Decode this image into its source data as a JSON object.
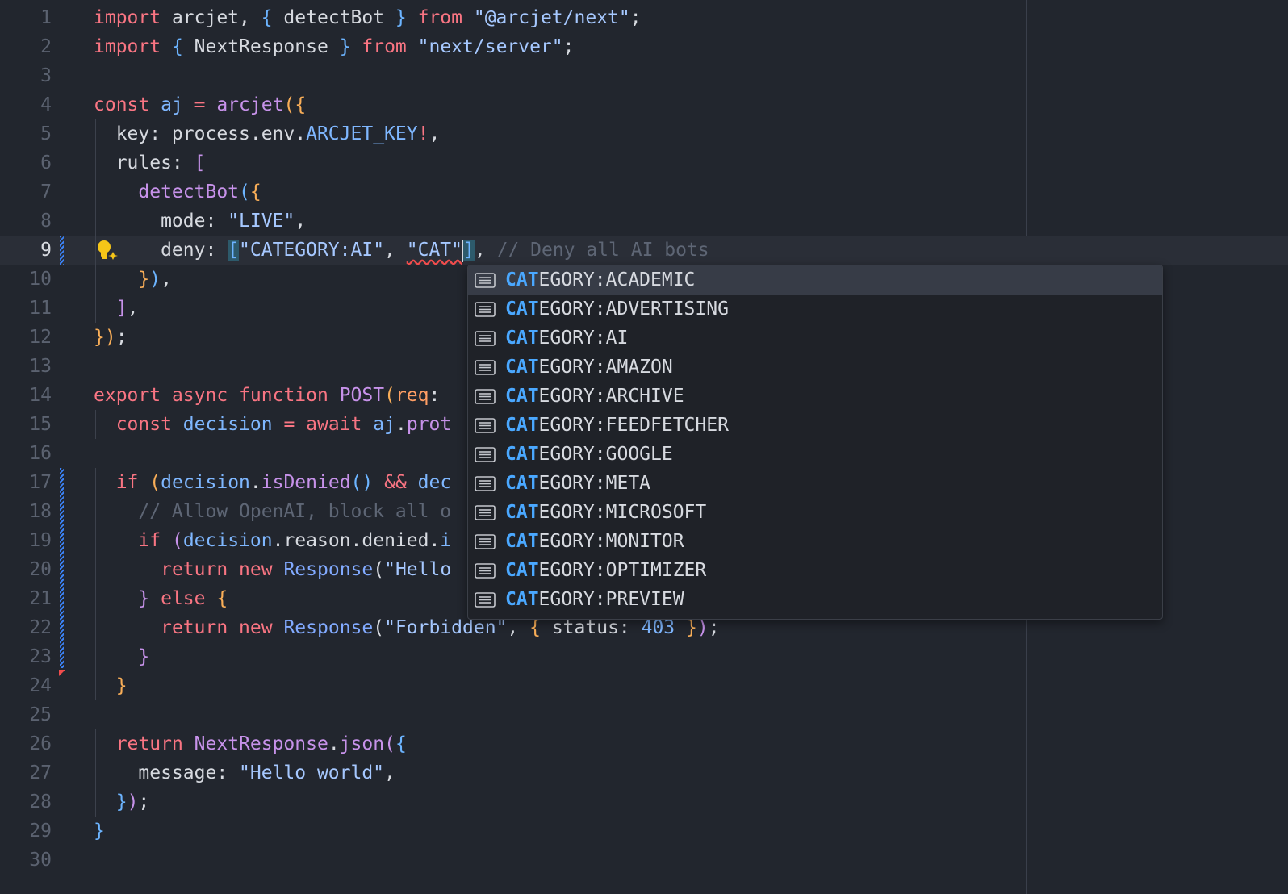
{
  "editor": {
    "active_line": 9,
    "lines": [
      {
        "n": "1",
        "tokens": [
          [
            "import",
            "t-kw"
          ],
          [
            " arcjet, ",
            "t-plain"
          ],
          [
            "{",
            "t-br3"
          ],
          [
            " detectBot ",
            "t-plain"
          ],
          [
            "}",
            "t-br3"
          ],
          [
            " from ",
            "t-kw"
          ],
          [
            "\"@arcjet/next\"",
            "t-str"
          ],
          [
            ";",
            "t-punc"
          ]
        ]
      },
      {
        "n": "2",
        "tokens": [
          [
            "import",
            "t-kw"
          ],
          [
            " ",
            "t-plain"
          ],
          [
            "{",
            "t-br3"
          ],
          [
            " NextResponse ",
            "t-plain"
          ],
          [
            "}",
            "t-br3"
          ],
          [
            " from ",
            "t-kw"
          ],
          [
            "\"next/server\"",
            "t-str"
          ],
          [
            ";",
            "t-punc"
          ]
        ]
      },
      {
        "n": "3",
        "tokens": []
      },
      {
        "n": "4",
        "tokens": [
          [
            "const",
            "t-kw"
          ],
          [
            " aj ",
            "t-var"
          ],
          [
            "=",
            "t-op"
          ],
          [
            " ",
            "t-plain"
          ],
          [
            "arcjet",
            "t-fn"
          ],
          [
            "(",
            "t-br1"
          ],
          [
            "{",
            "t-br1"
          ]
        ]
      },
      {
        "n": "5",
        "tokens": [
          [
            "  key: process.env.",
            "t-plain"
          ],
          [
            "ARCJET_KEY",
            "t-var"
          ],
          [
            "!",
            "t-op"
          ],
          [
            ",",
            "t-punc"
          ]
        ]
      },
      {
        "n": "6",
        "tokens": [
          [
            "  rules: ",
            "t-plain"
          ],
          [
            "[",
            "t-br2"
          ]
        ]
      },
      {
        "n": "7",
        "tokens": [
          [
            "    ",
            "t-plain"
          ],
          [
            "detectBot",
            "t-fn"
          ],
          [
            "(",
            "t-br3"
          ],
          [
            "{",
            "t-br1"
          ]
        ]
      },
      {
        "n": "8",
        "tokens": [
          [
            "      mode: ",
            "t-plain"
          ],
          [
            "\"LIVE\"",
            "t-str"
          ],
          [
            ",",
            "t-punc"
          ]
        ]
      },
      {
        "n": "9",
        "tokens": [
          [
            "      deny: ",
            "t-plain"
          ],
          [
            "[",
            "t-br3 t-bhl"
          ],
          [
            "\"CATEGORY:AI\"",
            "t-str"
          ],
          [
            ", ",
            "t-punc"
          ],
          [
            "\"CAT\"",
            "t-str t-squig"
          ],
          [
            "|",
            "cursor"
          ],
          [
            "]",
            "t-br3 t-bhl"
          ],
          [
            ", ",
            "t-punc"
          ],
          [
            "// Deny all AI bots",
            "t-com"
          ]
        ]
      },
      {
        "n": "10",
        "tokens": [
          [
            "    ",
            "t-plain"
          ],
          [
            "}",
            "t-br1"
          ],
          [
            ")",
            "t-br3"
          ],
          [
            ",",
            "t-punc"
          ]
        ]
      },
      {
        "n": "11",
        "tokens": [
          [
            "  ",
            "t-plain"
          ],
          [
            "]",
            "t-br2"
          ],
          [
            ",",
            "t-punc"
          ]
        ]
      },
      {
        "n": "12",
        "tokens": [
          [
            "}",
            "t-br1"
          ],
          [
            ")",
            "t-br1"
          ],
          [
            ";",
            "t-punc"
          ]
        ]
      },
      {
        "n": "13",
        "tokens": []
      },
      {
        "n": "14",
        "tokens": [
          [
            "export",
            "t-kw"
          ],
          [
            " ",
            "t-plain"
          ],
          [
            "async",
            "t-kw"
          ],
          [
            " ",
            "t-plain"
          ],
          [
            "function",
            "t-kw"
          ],
          [
            " ",
            "t-plain"
          ],
          [
            "POST",
            "t-fn"
          ],
          [
            "(",
            "t-br1"
          ],
          [
            "req",
            "t-kw2"
          ],
          [
            ": ",
            "t-plain"
          ]
        ]
      },
      {
        "n": "15",
        "tokens": [
          [
            "  ",
            "t-plain"
          ],
          [
            "const",
            "t-kw"
          ],
          [
            " decision ",
            "t-var"
          ],
          [
            "=",
            "t-op"
          ],
          [
            " ",
            "t-plain"
          ],
          [
            "await",
            "t-kw"
          ],
          [
            " aj",
            "t-var"
          ],
          [
            ".",
            "t-punc"
          ],
          [
            "prot",
            "t-fn"
          ]
        ]
      },
      {
        "n": "16",
        "tokens": []
      },
      {
        "n": "17",
        "tokens": [
          [
            "  ",
            "t-plain"
          ],
          [
            "if",
            "t-kw"
          ],
          [
            " ",
            "t-plain"
          ],
          [
            "(",
            "t-br1"
          ],
          [
            "decision",
            "t-var"
          ],
          [
            ".",
            "t-punc"
          ],
          [
            "isDenied",
            "t-fn"
          ],
          [
            "()",
            "t-br3"
          ],
          [
            " ",
            "t-plain"
          ],
          [
            "&&",
            "t-op"
          ],
          [
            " ",
            "t-plain"
          ],
          [
            "dec",
            "t-var"
          ]
        ]
      },
      {
        "n": "18",
        "tokens": [
          [
            "    ",
            "t-plain"
          ],
          [
            "// Allow OpenAI, block all o",
            "t-com"
          ]
        ]
      },
      {
        "n": "19",
        "tokens": [
          [
            "    ",
            "t-plain"
          ],
          [
            "if",
            "t-kw"
          ],
          [
            " ",
            "t-plain"
          ],
          [
            "(",
            "t-br2"
          ],
          [
            "decision",
            "t-var"
          ],
          [
            ".reason.denied.",
            "t-plain"
          ],
          [
            "i",
            "t-var"
          ]
        ]
      },
      {
        "n": "20",
        "tokens": [
          [
            "      ",
            "t-plain"
          ],
          [
            "return",
            "t-kw"
          ],
          [
            " ",
            "t-plain"
          ],
          [
            "new",
            "t-kw"
          ],
          [
            " ",
            "t-plain"
          ],
          [
            "Response",
            "t-cls"
          ],
          [
            "(",
            "t-plain"
          ],
          [
            "\"Hello",
            "t-str"
          ]
        ]
      },
      {
        "n": "21",
        "tokens": [
          [
            "    ",
            "t-plain"
          ],
          [
            "}",
            "t-br2"
          ],
          [
            " ",
            "t-plain"
          ],
          [
            "else",
            "t-kw"
          ],
          [
            " ",
            "t-plain"
          ],
          [
            "{",
            "t-br1"
          ]
        ]
      },
      {
        "n": "22",
        "tokens": [
          [
            "      ",
            "t-plain"
          ],
          [
            "return",
            "t-kw"
          ],
          [
            " ",
            "t-plain"
          ],
          [
            "new",
            "t-kw"
          ],
          [
            " ",
            "t-plain"
          ],
          [
            "Response",
            "t-cls"
          ],
          [
            "(",
            "t-plain"
          ],
          [
            "\"Forbidden\"",
            "t-str"
          ],
          [
            ", ",
            "t-punc"
          ],
          [
            "{",
            "t-br1"
          ],
          [
            " status: ",
            "t-plain"
          ],
          [
            "403",
            "t-num"
          ],
          [
            " ",
            "t-plain"
          ],
          [
            "}",
            "t-br1"
          ],
          [
            ")",
            "t-br2"
          ],
          [
            ";",
            "t-punc"
          ]
        ]
      },
      {
        "n": "23",
        "tokens": [
          [
            "    ",
            "t-plain"
          ],
          [
            "}",
            "t-br2"
          ]
        ]
      },
      {
        "n": "24",
        "tokens": [
          [
            "  ",
            "t-plain"
          ],
          [
            "}",
            "t-br1"
          ]
        ]
      },
      {
        "n": "25",
        "tokens": []
      },
      {
        "n": "26",
        "tokens": [
          [
            "  ",
            "t-plain"
          ],
          [
            "return",
            "t-kw"
          ],
          [
            " ",
            "t-plain"
          ],
          [
            "NextResponse",
            "t-fn"
          ],
          [
            ".",
            "t-punc"
          ],
          [
            "json",
            "t-fn"
          ],
          [
            "(",
            "t-br2"
          ],
          [
            "{",
            "t-br3"
          ]
        ]
      },
      {
        "n": "27",
        "tokens": [
          [
            "    message: ",
            "t-plain"
          ],
          [
            "\"Hello world\"",
            "t-str"
          ],
          [
            ",",
            "t-punc"
          ]
        ]
      },
      {
        "n": "28",
        "tokens": [
          [
            "  ",
            "t-plain"
          ],
          [
            "}",
            "t-br3"
          ],
          [
            ")",
            "t-br2"
          ],
          [
            ";",
            "t-punc"
          ]
        ]
      },
      {
        "n": "29",
        "tokens": [
          [
            "}",
            "t-br3"
          ]
        ]
      },
      {
        "n": "30",
        "tokens": []
      }
    ]
  },
  "suggest": {
    "match_prefix": "CAT",
    "icon": "text-icon",
    "selected_index": 0,
    "items": [
      "CATEGORY:ACADEMIC",
      "CATEGORY:ADVERTISING",
      "CATEGORY:AI",
      "CATEGORY:AMAZON",
      "CATEGORY:ARCHIVE",
      "CATEGORY:FEEDFETCHER",
      "CATEGORY:GOOGLE",
      "CATEGORY:META",
      "CATEGORY:MICROSOFT",
      "CATEGORY:MONITOR",
      "CATEGORY:OPTIMIZER",
      "CATEGORY:PREVIEW"
    ]
  },
  "gutter": {
    "lightbulb_icon": "lightbulb-icon"
  }
}
